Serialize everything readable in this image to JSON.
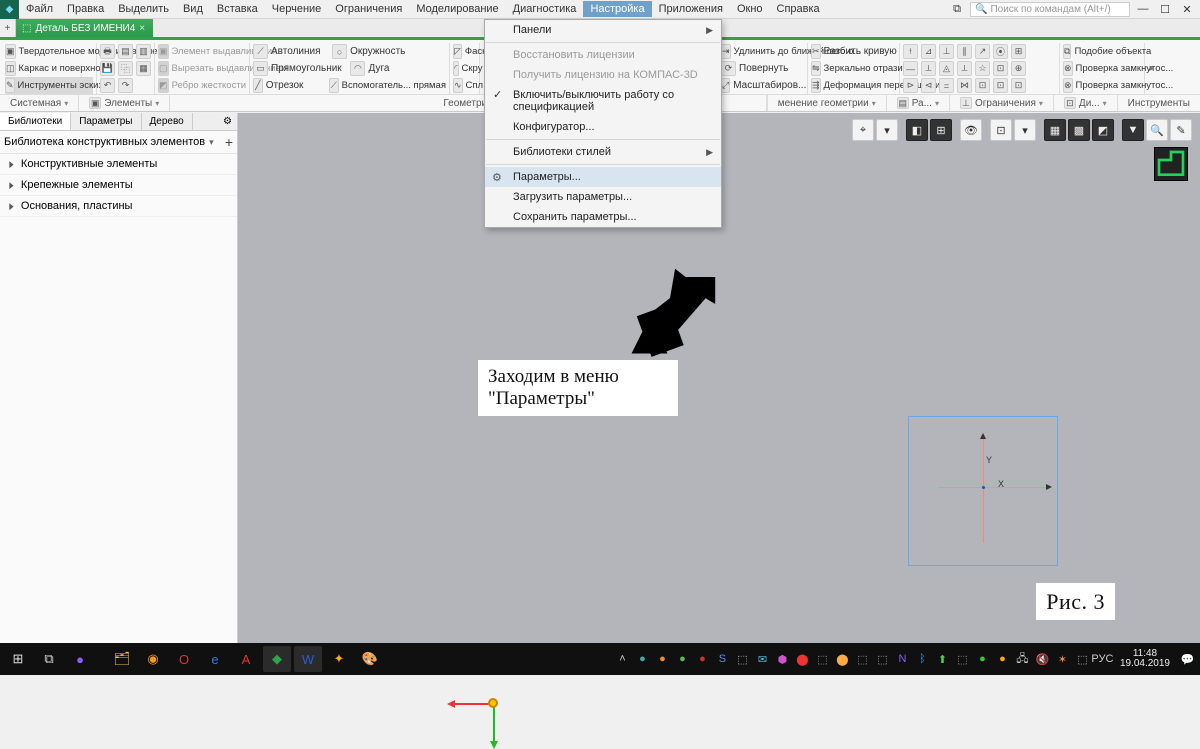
{
  "menubar": {
    "items": [
      "Файл",
      "Правка",
      "Выделить",
      "Вид",
      "Вставка",
      "Черчение",
      "Ограничения",
      "Моделирование",
      "Диагностика",
      "Настройка",
      "Приложения",
      "Окно",
      "Справка"
    ],
    "active_index": 9,
    "search_placeholder": "Поиск по командам (Alt+/)"
  },
  "doc_tab": {
    "title": "Деталь БЕЗ ИМЕНИ4"
  },
  "ribbon": {
    "groups_left": [
      {
        "items": [
          "Твердотельное моделирование",
          "Каркас и поверхности",
          "Инструменты эскиза"
        ]
      },
      {
        "items": [
          "Элемент выдавливания",
          "Вырезать выдавливанием",
          "Ребро жесткости"
        ]
      }
    ],
    "cmds": {
      "autoline": "Автолиния",
      "circle": "Окружность",
      "rect": "Прямоугольник",
      "arc": "Дуга",
      "seg": "Отрезок",
      "aux": "Вспомогатель... прямая",
      "chamfer": "Фаск",
      "round": "Скру",
      "spl": "Спл объ",
      "extend": "Удлинить до ближайшего о...",
      "rotate": "Повернуть",
      "scale": "Масштабиров...",
      "split": "Разбить кривую",
      "mirror": "Зеркально отразить",
      "deform": "Деформация перемещением",
      "similar": "Подобие объекта",
      "closed": "Проверка замкнутос...",
      "closed2": "Проверка замкнутос..."
    },
    "footer": {
      "sys": "Системная",
      "elem": "Элементы",
      "geom": "Геометрия",
      "change": "менение геометрии",
      "ra": "Ра...",
      "ogr": "Ограничения",
      "di": "Ди...",
      "instr": "Инструменты"
    }
  },
  "left_panel": {
    "tabs": [
      "Библиотеки",
      "Параметры",
      "Дерево"
    ],
    "active_tab": 0,
    "header": "Библиотека конструктивных элементов",
    "items": [
      "Конструктивные элементы",
      "Крепежные элементы",
      "Основания, пластины"
    ]
  },
  "dropdown": {
    "items": [
      {
        "label": "Панели",
        "submenu": true
      },
      {
        "sep": true
      },
      {
        "label": "Восстановить лицензии",
        "disabled": true
      },
      {
        "label": "Получить лицензию на КОМПАС-3D",
        "disabled": true
      },
      {
        "label": "Включить/выключить работу со спецификацией",
        "checked": true
      },
      {
        "label": "Конфигуратор..."
      },
      {
        "sep": true
      },
      {
        "label": "Библиотеки стилей",
        "submenu": true
      },
      {
        "sep": true
      },
      {
        "label": "Параметры...",
        "gear": true,
        "hovered": true
      },
      {
        "label": "Загрузить параметры..."
      },
      {
        "label": "Сохранить параметры..."
      }
    ]
  },
  "annotations": {
    "text1": "Заходим в меню \"Параметры\"",
    "text2": "Рис. 3"
  },
  "axes": {
    "x": "X",
    "y": "Y"
  },
  "taskbar": {
    "clock_time": "11:48",
    "clock_date": "19.04.2019",
    "lang": "РУС"
  }
}
